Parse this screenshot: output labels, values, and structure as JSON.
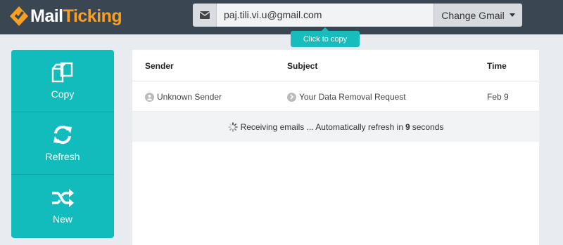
{
  "app": {
    "logo_part1": "Mail",
    "logo_part2": "Ticking"
  },
  "email": {
    "value": "paj.tili.vi.u@gmail.com",
    "change_label": "Change Gmail"
  },
  "tooltip": {
    "text": "Click to copy"
  },
  "sidebar": {
    "items": [
      {
        "label": "Copy",
        "icon": "copy-icon"
      },
      {
        "label": "Refresh",
        "icon": "refresh-icon"
      },
      {
        "label": "New",
        "icon": "shuffle-icon"
      }
    ]
  },
  "inbox": {
    "columns": {
      "sender": "Sender",
      "subject": "Subject",
      "time": "Time"
    },
    "rows": [
      {
        "sender": "Unknown Sender",
        "subject": "Your Data Removal Request",
        "time": "Feb 9"
      }
    ],
    "status": {
      "prefix": "Receiving emails ... Automatically refresh in",
      "seconds": "9",
      "suffix": "seconds"
    }
  },
  "colors": {
    "topbar": "#3a4752",
    "accent": "#12bcbc",
    "brand_orange": "#f7a023"
  }
}
